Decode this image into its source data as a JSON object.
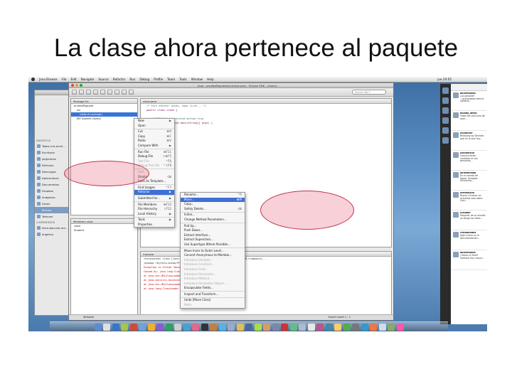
{
  "slide": {
    "title": "La clase ahora pertenece al paquete"
  },
  "mac_menubar": {
    "items": [
      "Java Browse",
      "File",
      "Edit",
      "Navigate",
      "Source",
      "Refactor",
      "Run",
      "Debug",
      "Profile",
      "Team",
      "Tools",
      "Window",
      "Help"
    ],
    "clock": "jue 20:05"
  },
  "finder": {
    "section_favorites": "Favoritos",
    "items": [
      "Todos mis archi...",
      "Escritorio",
      "jorgleiman",
      "Películas",
      "Descargas",
      "Aplicaciones",
      "Documentos",
      "Dropbox",
      "Imágenes",
      "Libros",
      "Música",
      "Telecom"
    ],
    "section_shared": "Compartidos",
    "shared_items": [
      "terra-baccolo-ma...",
      "angelica"
    ]
  },
  "eclipse": {
    "window_title": "Java - pruebaPaquete/src/clase.java - Eclipse SDK - /Users/...",
    "search_placeholder": "Search Bit-7",
    "package_tab": "Package Ex",
    "tree": [
      "pruebaPaquete",
      "src",
      "(default package)",
      "JRE System Library"
    ],
    "outline_tab": "Members view",
    "outline_rows": [
      "clase",
      "Student"
    ],
    "editor_tab": "clase.java",
    "code": [
      "/* Para obtener ayuda, haga click... */",
      "public class clase {",
      "",
      "   // TODO Auto-generated method stub",
      "   public static void main(String[] args) {",
      "   }",
      "}"
    ],
    "console_tab": "Console",
    "console_lines": [
      "<terminated> clase [Java Application] /System/Library/Frameworks/JavaVM.framework/...",
      "javaapp.rtp/hola-mundo/Projects/Student/...",
      "Exception in thread \"main\" java.lang.NoClassDefFoundError: clase",
      "Caused by: java.lang.ClassNotFoundException: clase",
      "  at java.net.URLClassLoader$1.run(URLClassLoader.java:202)",
      "  at java.security.AccessController.doPrivileged(Native Method)",
      "  at java.net.URLClassLoader.findClass(URLClassLoader.java:190)",
      "  at java.lang.ClassLoader.loadClass(ClassLoader.java:306)"
    ],
    "status_left": "Writable",
    "status_right": "Smart Insert   1 : 1"
  },
  "context_menu_1": {
    "items": [
      {
        "label": "New",
        "shortcut": "▶",
        "disabled": false
      },
      {
        "label": "Open",
        "shortcut": "",
        "disabled": false
      },
      {
        "sep": true
      },
      {
        "label": "Cut",
        "shortcut": "⌘X",
        "disabled": false
      },
      {
        "label": "Copy",
        "shortcut": "⌘C",
        "disabled": false
      },
      {
        "label": "Paste",
        "shortcut": "⌘V",
        "disabled": false
      },
      {
        "label": "Compare With",
        "shortcut": "▶",
        "disabled": false
      },
      {
        "sep": true
      },
      {
        "label": "Run File",
        "shortcut": "⌘F11",
        "disabled": false
      },
      {
        "label": "Debug File",
        "shortcut": "⇧⌘F5",
        "disabled": false
      },
      {
        "label": "Test File",
        "shortcut": "⌃F6",
        "disabled": true
      },
      {
        "label": "Debug Test File",
        "shortcut": "⌃⇧F6",
        "disabled": true
      },
      {
        "sep": true
      },
      {
        "label": "Add",
        "shortcut": "",
        "disabled": true
      },
      {
        "label": "Delete",
        "shortcut": "⌫",
        "disabled": false
      },
      {
        "label": "Save As Template...",
        "shortcut": "",
        "disabled": false
      },
      {
        "sep": true
      },
      {
        "label": "Find Usages",
        "shortcut": "^F7",
        "disabled": false
      },
      {
        "label": "Refactor",
        "shortcut": "▶",
        "disabled": false,
        "highlight": true
      },
      {
        "sep": true
      },
      {
        "label": "Submitted for...",
        "shortcut": "▶",
        "disabled": false
      },
      {
        "sep": true
      },
      {
        "label": "File Members",
        "shortcut": "⌘F12",
        "disabled": false
      },
      {
        "label": "File Hierarchy",
        "shortcut": "⇧F12",
        "disabled": false
      },
      {
        "label": "Local History",
        "shortcut": "▶",
        "disabled": false
      },
      {
        "sep": true
      },
      {
        "label": "Tools",
        "shortcut": "▶",
        "disabled": false
      },
      {
        "label": "Properties",
        "shortcut": "",
        "disabled": false
      }
    ]
  },
  "context_menu_2": {
    "items": [
      {
        "label": "Rename...",
        "shortcut": "^R",
        "disabled": false
      },
      {
        "label": "Move...",
        "shortcut": "⌘M",
        "disabled": false,
        "highlight": true
      },
      {
        "label": "Copy...",
        "shortcut": "",
        "disabled": false
      },
      {
        "label": "Safely Delete...",
        "shortcut": "⌫",
        "disabled": false
      },
      {
        "sep": true
      },
      {
        "label": "Inline...",
        "shortcut": "",
        "disabled": false
      },
      {
        "label": "Change Method Parameters...",
        "shortcut": "",
        "disabled": false
      },
      {
        "sep": true
      },
      {
        "label": "Pull Up...",
        "shortcut": "",
        "disabled": false
      },
      {
        "label": "Push Down...",
        "shortcut": "",
        "disabled": false
      },
      {
        "label": "Extract Interface...",
        "shortcut": "",
        "disabled": false
      },
      {
        "label": "Extract Superclass...",
        "shortcut": "",
        "disabled": false
      },
      {
        "label": "Use Supertype Where Possible...",
        "shortcut": "",
        "disabled": false
      },
      {
        "sep": true
      },
      {
        "label": "Move Inner to Outer Level...",
        "shortcut": "",
        "disabled": false
      },
      {
        "label": "Convert Anonymous to Member...",
        "shortcut": "",
        "disabled": false
      },
      {
        "label": "Introduce Variable...",
        "shortcut": "",
        "disabled": true
      },
      {
        "label": "Introduce Constant...",
        "shortcut": "",
        "disabled": true
      },
      {
        "label": "Introduce Field...",
        "shortcut": "",
        "disabled": true
      },
      {
        "label": "Introduce Parameter...",
        "shortcut": "",
        "disabled": true
      },
      {
        "label": "Introduce Method...",
        "shortcut": "",
        "disabled": true
      },
      {
        "label": "Introduce Parameter Object...",
        "shortcut": "",
        "disabled": true
      },
      {
        "label": "Encapsulate Fields...",
        "shortcut": "",
        "disabled": false
      },
      {
        "sep": true
      },
      {
        "label": "Inspect and Transform...",
        "shortcut": "",
        "disabled": false
      },
      {
        "sep": true
      },
      {
        "label": "Undo [Move Class]",
        "shortcut": "",
        "disabled": false
      },
      {
        "label": "Redo",
        "shortcut": "",
        "disabled": true
      }
    ]
  },
  "twitter": {
    "tweets": [
      {
        "user": "dolormundo",
        "text": "¿Lo pasaste? ...actualizado todo el sistema..."
      },
      {
        "user": "mundo_ideas",
        "text": "Fotos del concurso de ayer..."
      },
      {
        "user": "Escadrille",
        "text": "Browsing by Decade: qué es lo que hay..."
      },
      {
        "user": "Alexnoticia",
        "text": "Comunicación centrada en las personas..."
      },
      {
        "user": "jorlesmundo",
        "text": "En el evento de Apple, Dropbox sincroniza..."
      },
      {
        "user": "Alexnoticia",
        "text": "Nuevo Chrome: se actualiza solo sobre Lion..."
      },
      {
        "user": "iLouAbe",
        "text": "Después de la reunión ya tengo las fotos..."
      },
      {
        "user": "relcamnotes",
        "text": "Algo nuevo en la documentación..."
      },
      {
        "user": "dolormundo",
        "text": "¿Vieron el final? mañana hay nueva..."
      }
    ]
  },
  "colors": {
    "highlight": "#3d6fd6",
    "annotation": "#c0324a"
  }
}
